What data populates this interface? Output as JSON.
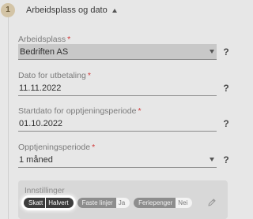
{
  "step": {
    "number": "1"
  },
  "section": {
    "title": "Arbeidsplass og dato"
  },
  "fields": {
    "arbeidsplass": {
      "label": "Arbeidsplass",
      "required": "*",
      "value": "Bedriften AS"
    },
    "dato_utbetaling": {
      "label": "Dato for utbetaling",
      "required": "*",
      "value": "11.11.2022"
    },
    "startdato": {
      "label": "Startdato for opptjeningsperiode",
      "required": "*",
      "value": "01.10.2022"
    },
    "opptjeningsperiode": {
      "label": "Opptjeningsperiode",
      "required": "*",
      "value": "1 måned"
    }
  },
  "help": {
    "symbol": "?"
  },
  "settings": {
    "title": "Innstillinger",
    "chips": [
      {
        "key": "Skatt",
        "value": "Halvert"
      },
      {
        "key": "Faste linjer",
        "value": "Ja"
      },
      {
        "key": "Feriepenger",
        "value": "Nei"
      }
    ]
  },
  "icons": {
    "section_toggle": "caret-up-icon",
    "dropdown": "caret-down-icon",
    "help": "help-icon",
    "edit": "pencil-icon"
  },
  "colors": {
    "background": "#e7e7e7",
    "required": "#d23a3a",
    "step_badge": "#d3c4a6",
    "chip_active": "#3d3d3d"
  }
}
